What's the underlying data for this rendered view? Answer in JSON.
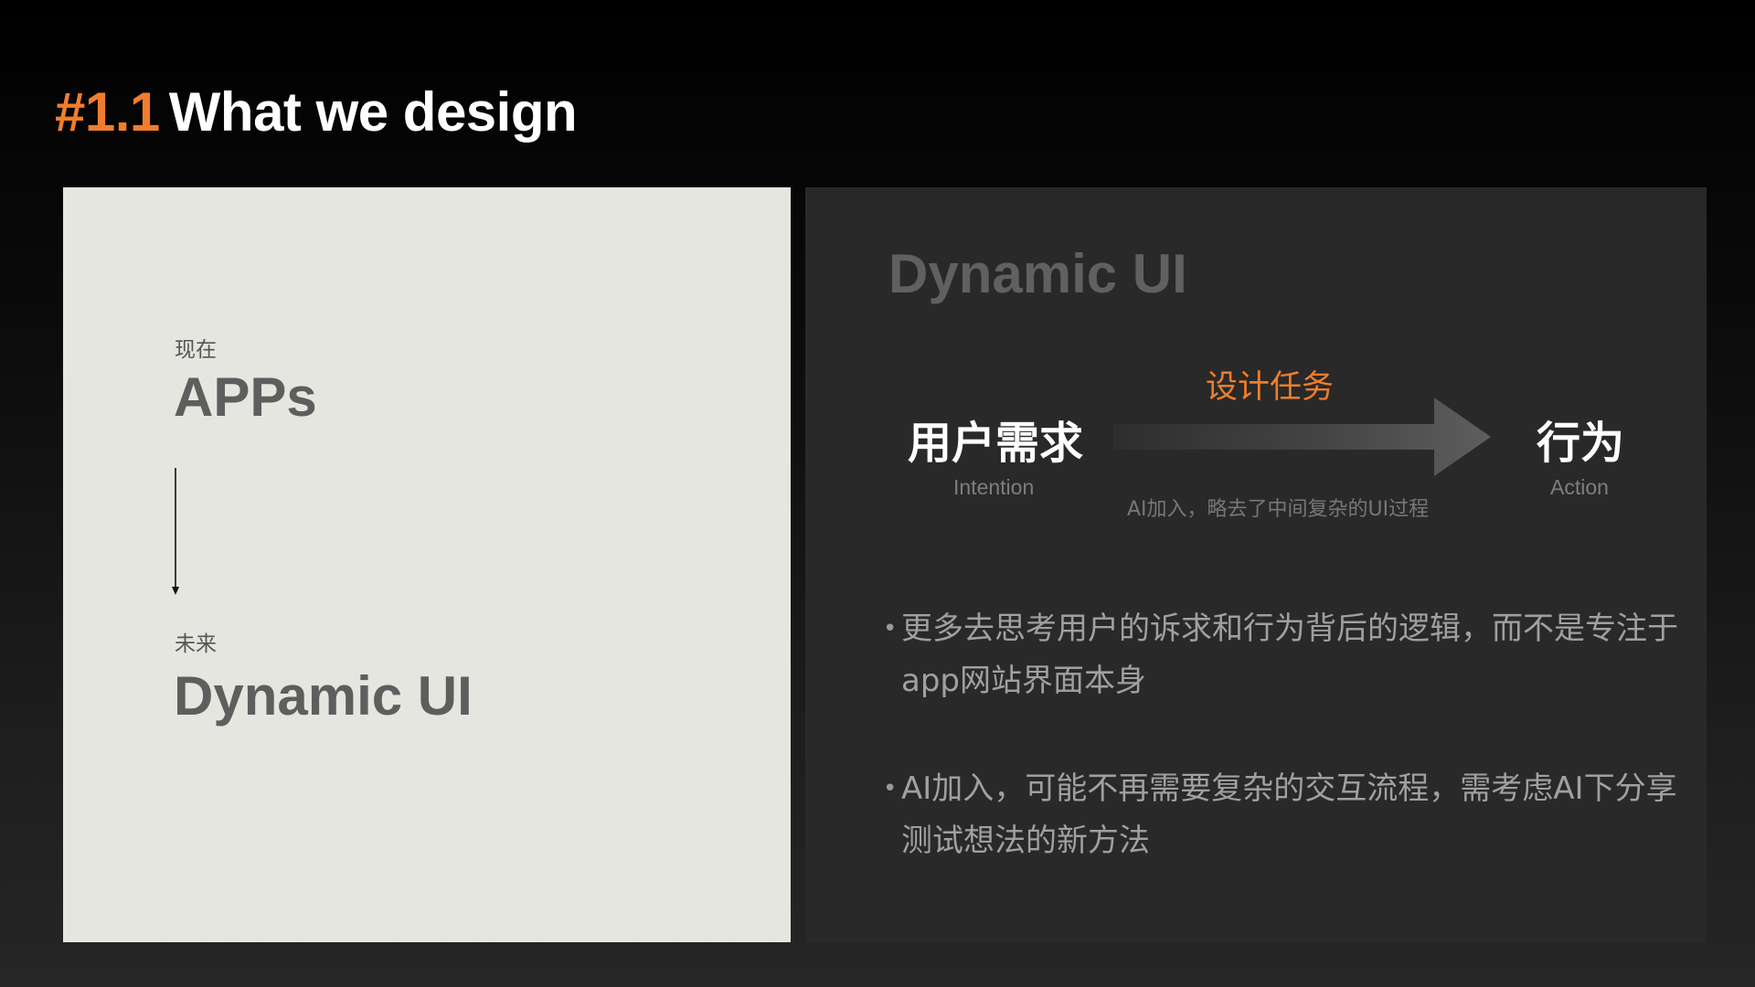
{
  "title": {
    "number": "#1.1",
    "text": "What we design"
  },
  "left_panel": {
    "now_label": "现在",
    "now_value": "APPs",
    "future_label": "未来",
    "future_value": "Dynamic UI"
  },
  "right_panel": {
    "title": "Dynamic UI",
    "source": {
      "cn": "用户需求",
      "en": "Intention"
    },
    "task_label": "设计任务",
    "note": "AI加入，略去了中间复杂的UI过程",
    "target": {
      "cn": "行为",
      "en": "Action"
    },
    "bullets": [
      "更多去思考用户的诉求和行为背后的逻辑，而不是专注于app网站界面本身",
      "AI加入，可能不再需要复杂的交互流程，需考虑AI下分享测试想法的新方法"
    ]
  },
  "colors": {
    "accent": "#ef7d2d",
    "left_panel_bg": "#e5e6e0",
    "right_panel_bg": "#292929"
  }
}
